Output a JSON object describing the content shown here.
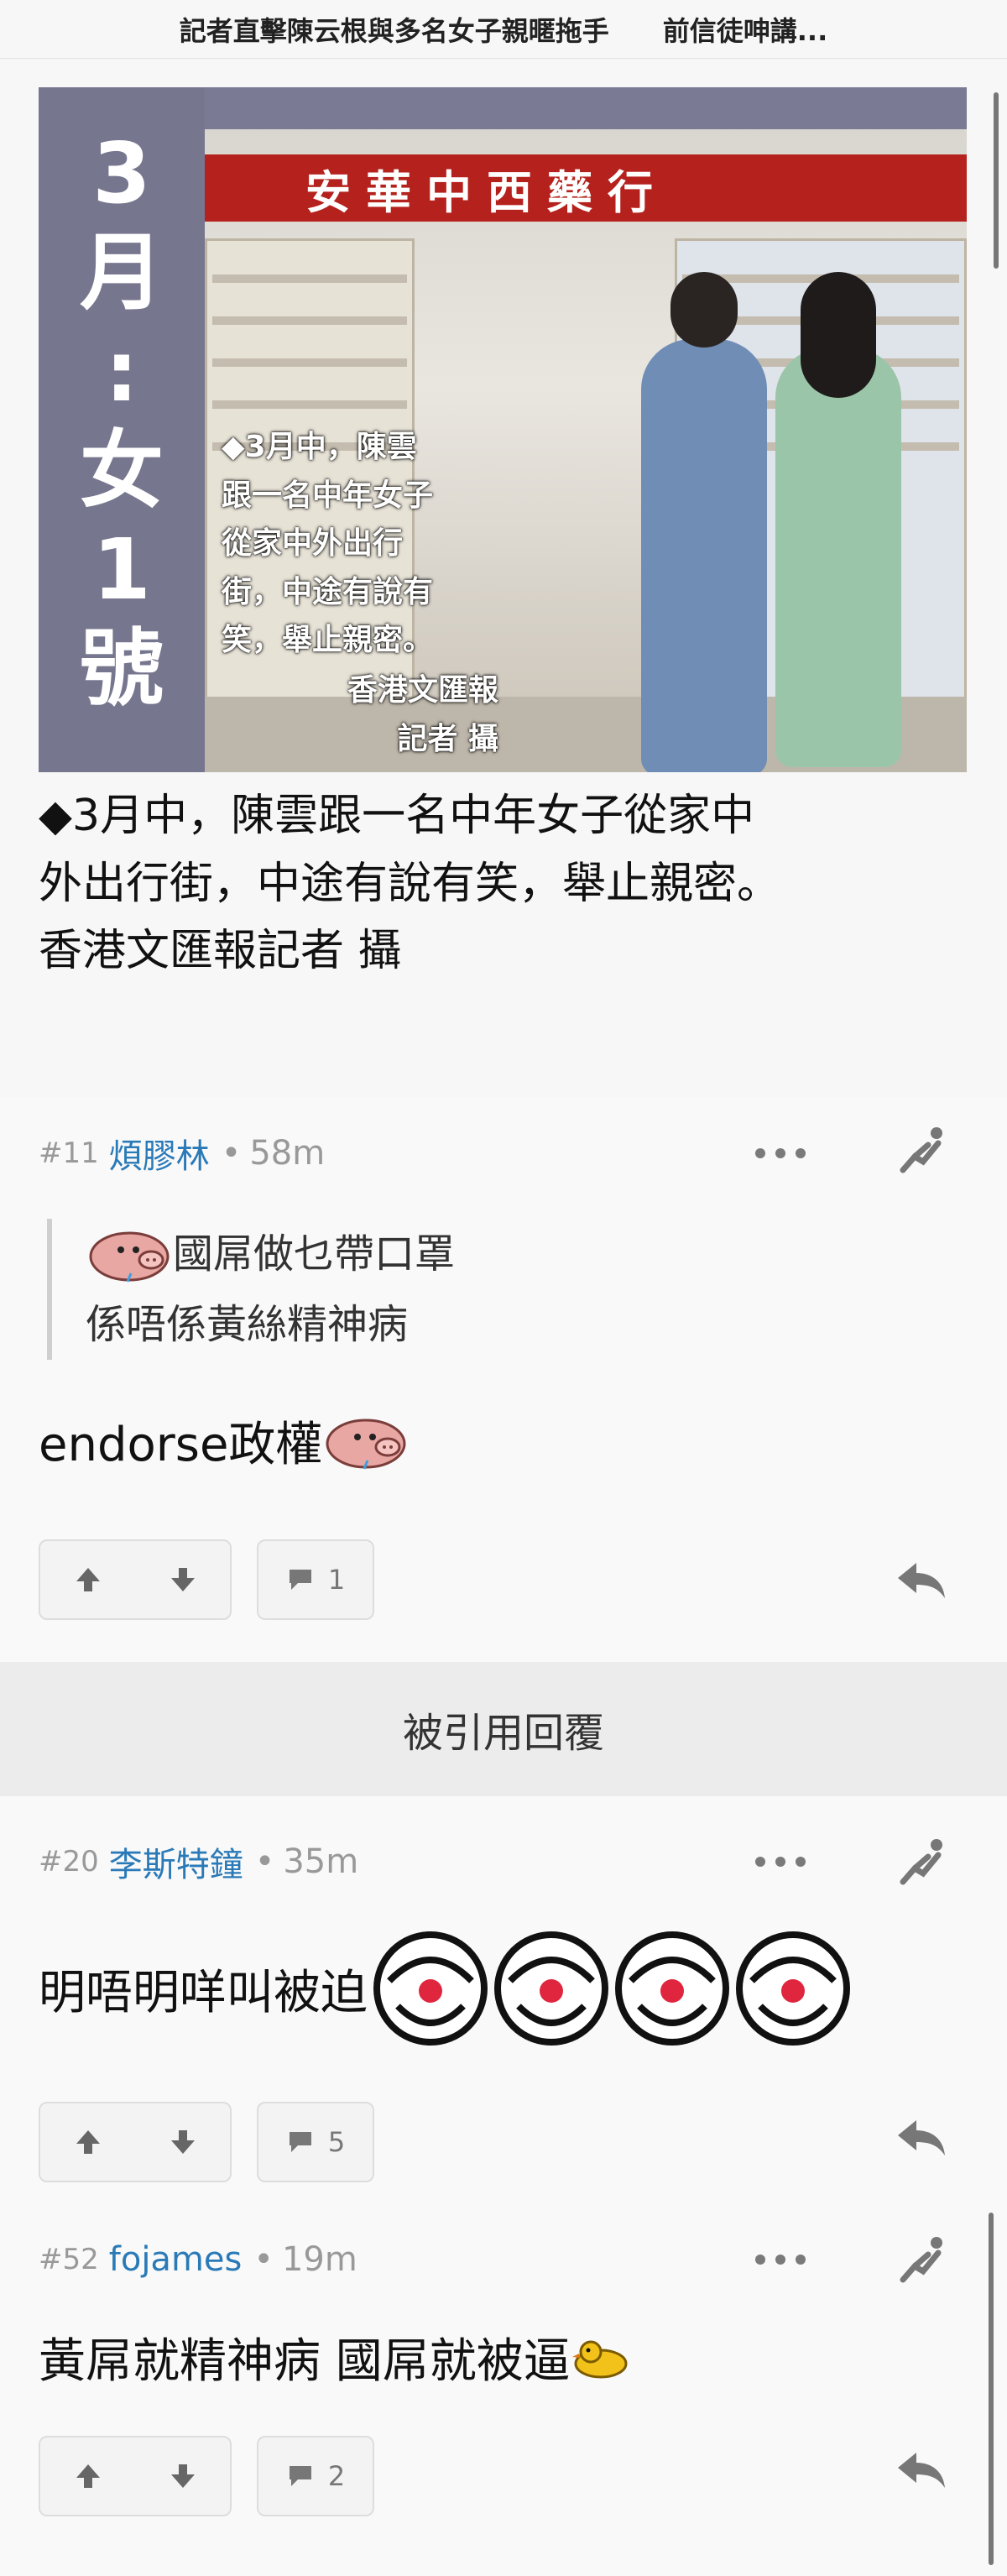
{
  "header": {
    "left_title": "記者直擊陳云根與多名女子親暱拖手",
    "right_title": "前信徒呻講..."
  },
  "photo": {
    "side_label": [
      "3",
      "月",
      ":",
      "女",
      "1",
      "號"
    ],
    "shop_sign": "安華中西藥行",
    "overlay_caption": "◆3月中，陳雲\n跟一名中年女子\n從家中外出行\n街，中途有說有\n笑，舉止親密。",
    "overlay_credit": "香港文匯報\n記者 攝"
  },
  "article_caption": "◆3月中，陳雲跟一名中年女子從家中\n外出行街，中途有說有笑，舉止親密。\n香港文匯報記者 攝",
  "posts": [
    {
      "num": "#11",
      "user": "煩膠林",
      "time": "58m",
      "quote_line1": "國屌做乜帶口罩",
      "quote_line2": "係唔係黃絲精神病",
      "body": "endorse政權",
      "reply_count": "1"
    },
    {
      "num": "#20",
      "user": "李斯特鐘",
      "time": "35m",
      "body": "明唔明咩叫被迫",
      "reply_count": "5"
    },
    {
      "num": "#52",
      "user": "fojames",
      "time": "19m",
      "body": "黃屌就精神病 國屌就被逼",
      "reply_count": "2"
    }
  ],
  "section_bar_label": "被引用回覆",
  "icons": {
    "more": "more-dots-icon",
    "skip": "jump-icon",
    "upvote": "arrow-up-icon",
    "downvote": "arrow-down-icon",
    "comments": "chat-bubble-icon",
    "reply": "reply-arrow-icon"
  },
  "colors": {
    "username": "#2a7ab8",
    "shop_sign": "#b5221d",
    "photo_border": "#76768f"
  }
}
